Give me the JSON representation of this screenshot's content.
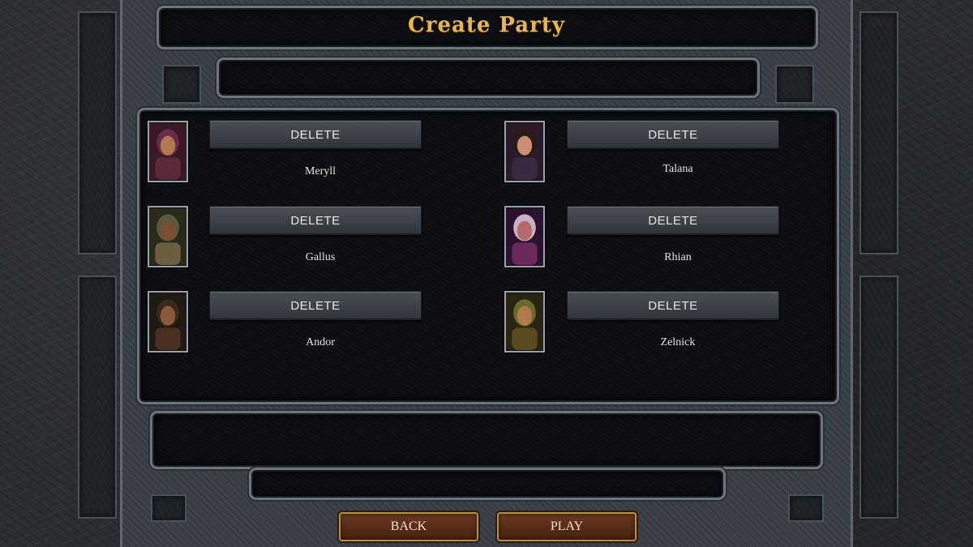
{
  "screen_title": "Create Party",
  "party": [
    {
      "name": "Meryll",
      "delete_label": "DELETE",
      "portrait_icon": "female-rogue-portrait",
      "skin": "#b07a52",
      "hair": "#6a2a4a",
      "garb": "#5a2a3a"
    },
    {
      "name": "Talana",
      "delete_label": "DELETE",
      "portrait_icon": "female-mage-portrait",
      "skin": "#c89070",
      "hair": "#2a1a12",
      "garb": "#3a2a40"
    },
    {
      "name": "Gallus",
      "delete_label": "DELETE",
      "portrait_icon": "male-fighter-portrait",
      "skin": "#7a4e30",
      "hair": "#5a5a3a",
      "garb": "#6a6040"
    },
    {
      "name": "Rhian",
      "delete_label": "DELETE",
      "portrait_icon": "female-warrior-portrait",
      "skin": "#b46a6a",
      "hair": "#c8b0c0",
      "garb": "#6a2a5a"
    },
    {
      "name": "Andor",
      "delete_label": "DELETE",
      "portrait_icon": "male-ranger-portrait",
      "skin": "#8a5a3a",
      "hair": "#3a2a18",
      "garb": "#4a3020"
    },
    {
      "name": "Zelnick",
      "delete_label": "DELETE",
      "portrait_icon": "male-thief-portrait",
      "skin": "#b07a4a",
      "hair": "#6a6a2a",
      "garb": "#5a4a20"
    }
  ],
  "footer": {
    "back_label": "BACK",
    "play_label": "PLAY"
  },
  "colors": {
    "title": "#e8b54a",
    "nav_button": "#5a2e18",
    "nav_border": "#b8903a"
  }
}
